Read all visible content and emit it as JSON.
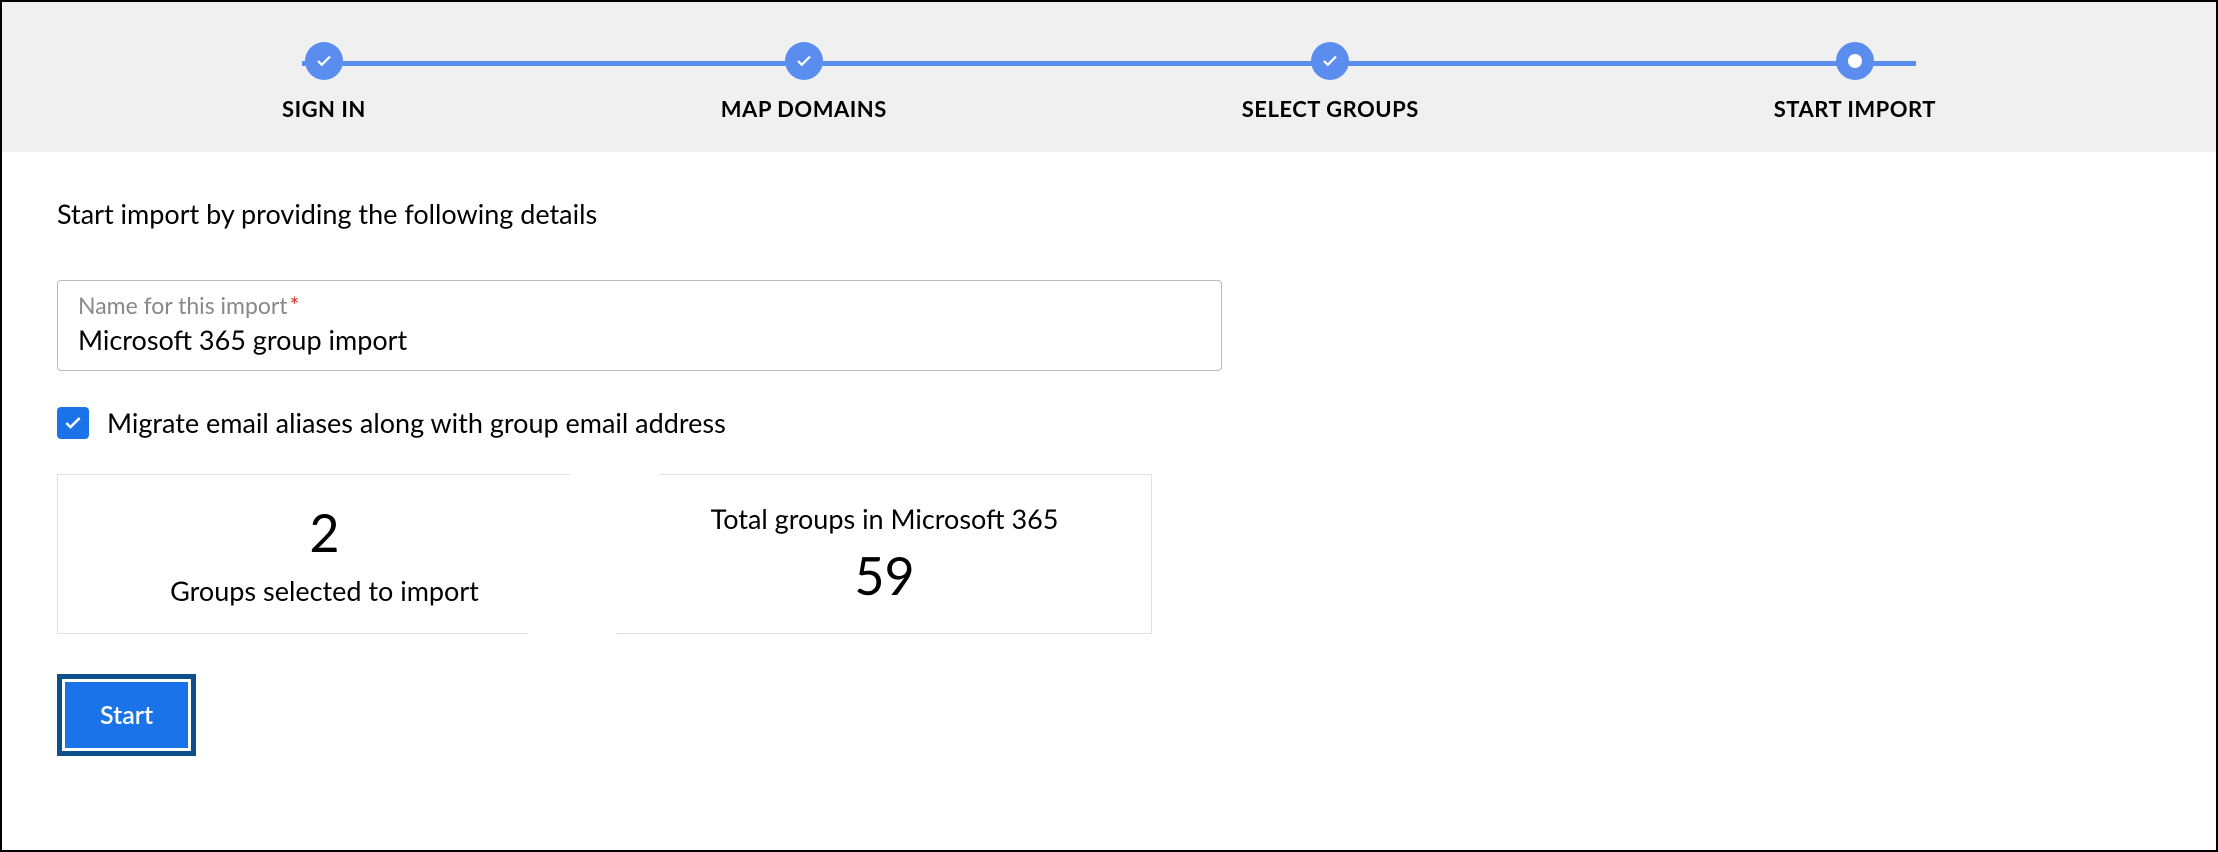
{
  "stepper": {
    "steps": [
      {
        "label": "SIGN IN",
        "state": "done"
      },
      {
        "label": "MAP DOMAINS",
        "state": "done"
      },
      {
        "label": "SELECT GROUPS",
        "state": "done"
      },
      {
        "label": "START IMPORT",
        "state": "current"
      }
    ]
  },
  "intro": "Start import by providing the following details",
  "form": {
    "nameLabel": "Name for this import",
    "nameValue": "Microsoft 365 group import",
    "migrateAliasesLabel": "Migrate email aliases along with group email address",
    "migrateAliasesChecked": true
  },
  "stats": {
    "selected": {
      "count": "2",
      "label": "Groups selected to import"
    },
    "total": {
      "label": "Total groups in Microsoft 365",
      "count": "59"
    }
  },
  "buttons": {
    "start": "Start"
  }
}
